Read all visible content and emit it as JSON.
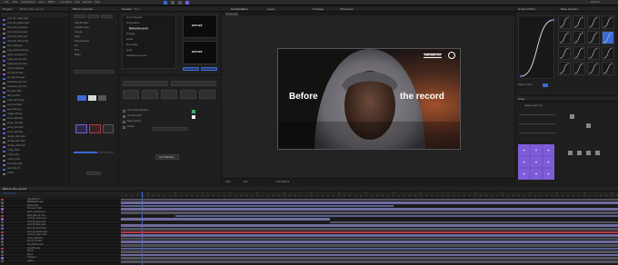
{
  "app": {
    "menu": [
      "File",
      "Edit",
      "Composition",
      "Layer",
      "Effect",
      "Animation",
      "View",
      "Window",
      "Help"
    ],
    "workspace": "Default"
  },
  "project": {
    "title": "Project",
    "comp_name": "Before the record",
    "files": [
      "shot_01_clean.mp4",
      "shot_02_grade.mp4",
      "shot_03_hood.mp4",
      "shot_04_face.mp4",
      "shot_05_wide.mp4",
      "shot_06_close.mp4",
      "intro_text.psd",
      "logo_enhanced.png",
      "grain_overlay.mov",
      "light_leak_01.mov",
      "light_leak_02.mov",
      "music_bed.wav",
      "sfx_hit_01.wav",
      "sfx_whoosh.wav",
      "transition_01.mov",
      "transition_02.mov",
      "lut_teal.cube",
      "title_card.ai",
      "lower_third.aep",
      "end_card.psd",
      "bg_plate.png",
      "mask_ref.png",
      "track_data.txt",
      "proxy_01.mp4",
      "proxy_02.mp4",
      "proxy_03.mp4",
      "render_v01.mp4",
      "render_v02.mp4",
      "render_v03.mp4",
      "comp_main",
      "comp_intro",
      "comp_outro",
      "precomp_text",
      "precomp_fx",
      "solids"
    ]
  },
  "effects": {
    "title": "Effect Controls",
    "items": [
      "Fast Box Blur",
      "Lumetri Color",
      "Curves",
      "Glow",
      "Drop Shadow",
      "Fill",
      "Tint",
      "Noise"
    ]
  },
  "panel_mid": {
    "tabs": [
      "Presets",
      "Files"
    ],
    "section": "Composition",
    "tree": [
      "Source Project",
      "Composition",
      "Before the record",
      "Footage",
      "Solids",
      "Pre-comps",
      "Audio",
      "Adjustment Layers"
    ],
    "thumb_label": "BEFORE",
    "buttons": [
      "Apply",
      "Replace",
      "Add",
      "Cancel"
    ],
    "options": [
      "Use Comp Duration",
      "Include Audio",
      "Keep Aspect",
      "Center"
    ],
    "add_button": "Add Stabilizer"
  },
  "viewer": {
    "tabs": [
      "Composition",
      "Layer",
      "Footage",
      "Flowchart"
    ],
    "overlay_left": "Before",
    "overlay_right": "the record",
    "badge": "ENHANCED",
    "zoom": "50%",
    "resolution": "Full",
    "timecode": "0;00;08;14"
  },
  "graph": {
    "title": "Graph Editor",
    "presets_title": "Ease Presets",
    "easing_label": "Ease In Out"
  },
  "align": {
    "title": "Align",
    "label": "Align Layers to:"
  },
  "timeline": {
    "title": "Before the record",
    "timecode": "0;00;08;14",
    "layers": [
      "Adjustment 1",
      "ENHANCED logo",
      "Before text",
      "the record text",
      "grain_overlay.mov",
      "light_leak_01.mov",
      "shot_06_close.mp4",
      "shot_05_wide.mp4",
      "shot_04_face.mp4",
      "shot_03_hood.mp4",
      "shot_02_grade.mp4",
      "shot_01_clean.mp4",
      "music_bed.wav",
      "sfx_hit_01.wav",
      "sfx_whoosh.wav",
      "bg_plate.png",
      "Solid 1",
      "Null 1",
      "Camera 1",
      "Light 1"
    ]
  },
  "colors": {
    "accent": "#3b6ad6",
    "purple": "#7e5cd8",
    "red": "#b43a46",
    "bar_purple": "#6f6a9e",
    "bar_blue": "#55608c",
    "bar_gray": "#53535e"
  }
}
